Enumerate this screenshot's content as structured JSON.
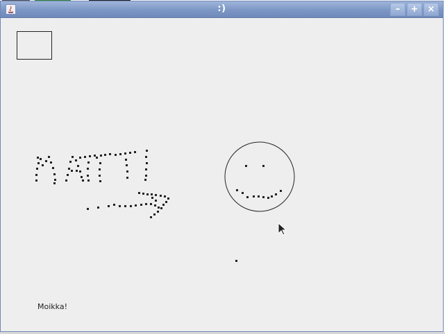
{
  "window": {
    "title": ":)",
    "controls": {
      "minimize": "–",
      "maximize": "+",
      "close": "×"
    }
  },
  "canvas": {
    "greeting": "Moikka!"
  }
}
